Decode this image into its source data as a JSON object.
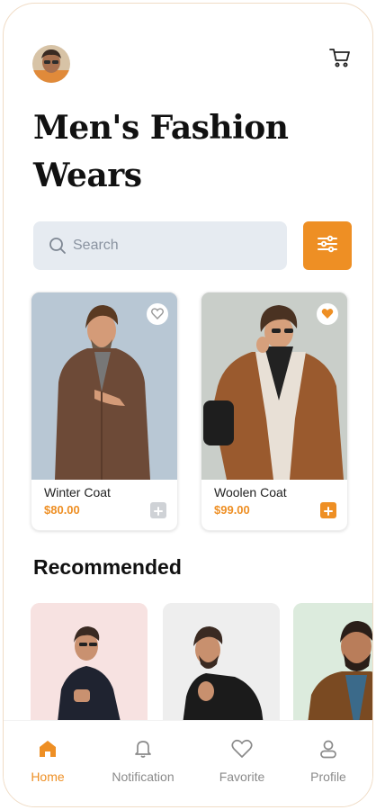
{
  "header": {
    "avatar_icon": "user-avatar",
    "cart_icon": "cart-icon",
    "title_line1": "Men's Fashion",
    "title_line2": "Wears"
  },
  "search": {
    "placeholder": "Search",
    "icon": "search-icon",
    "filter_icon": "sliders-icon"
  },
  "products": [
    {
      "name": "Winter Coat",
      "price": "$80.00",
      "favorite": false,
      "bg": "#b8c7d4",
      "coat": "#6d4a37"
    },
    {
      "name": "Woolen Coat",
      "price": "$99.00",
      "favorite": true,
      "bg": "#c9cec9",
      "coat": "#9a5a2e"
    }
  ],
  "recommended": {
    "title": "Recommended",
    "items": [
      {
        "bg": "#f7e2e1"
      },
      {
        "bg": "#eeeeee"
      },
      {
        "bg": "#dcebdd"
      }
    ]
  },
  "nav": {
    "items": [
      {
        "label": "Home",
        "icon": "home-icon",
        "active": true
      },
      {
        "label": "Notification",
        "icon": "bell-icon",
        "active": false
      },
      {
        "label": "Favorite",
        "icon": "heart-icon",
        "active": false
      },
      {
        "label": "Profile",
        "icon": "profile-icon",
        "active": false
      }
    ]
  },
  "colors": {
    "accent": "#ee8f24",
    "search_bg": "#e6ebf1",
    "nav_inactive": "#8a8a8a"
  }
}
